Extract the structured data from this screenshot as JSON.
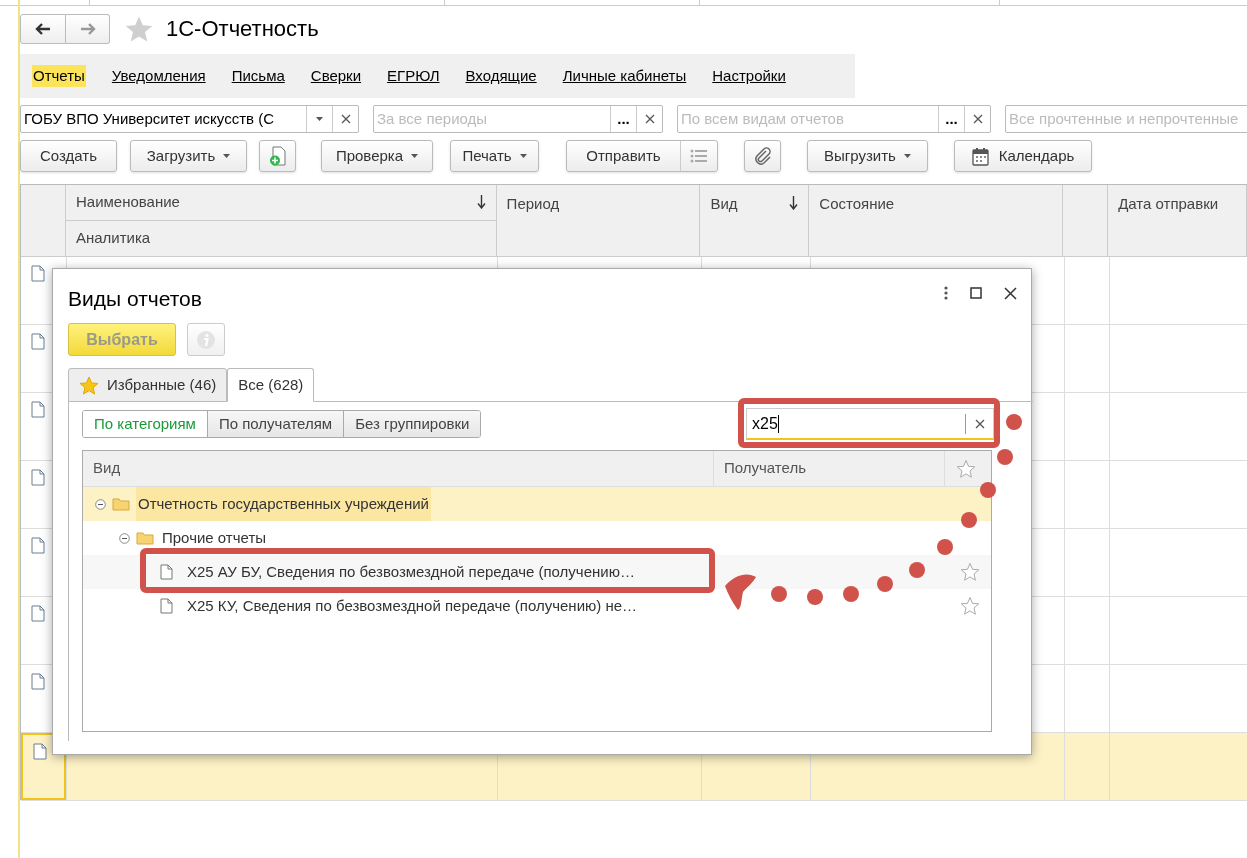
{
  "window": {
    "title": "1С-Отчетность",
    "favorite": false
  },
  "menu": [
    {
      "label": "Отчеты",
      "selected": true
    },
    {
      "label": "Уведомления",
      "selected": false
    },
    {
      "label": "Письма",
      "selected": false
    },
    {
      "label": "Сверки",
      "selected": false
    },
    {
      "label": "ЕГРЮЛ",
      "selected": false
    },
    {
      "label": "Входящие",
      "selected": false
    },
    {
      "label": "Личные кабинеты",
      "selected": false
    },
    {
      "label": "Настройки",
      "selected": false
    }
  ],
  "filters": [
    {
      "kind": "dropdown",
      "value": "ГОБУ ВПО Университет искусств (С"
    },
    {
      "kind": "choice",
      "placeholder": "За все периоды",
      "choose": "..."
    },
    {
      "kind": "choice",
      "placeholder": "По всем видам отчетов",
      "choose": "..."
    },
    {
      "kind": "plain",
      "placeholder": "Все прочтенные и непрочтенные"
    }
  ],
  "toolbar": [
    {
      "kind": "button",
      "label": "Создать"
    },
    {
      "kind": "menu",
      "label": "Загрузить"
    },
    {
      "kind": "new-doc"
    },
    {
      "kind": "menu",
      "label": "Проверка"
    },
    {
      "kind": "menu",
      "label": "Печать"
    },
    {
      "kind": "split",
      "label": "Отправить"
    },
    {
      "kind": "attach"
    },
    {
      "kind": "menu",
      "label": "Выгрузить"
    },
    {
      "kind": "calendar",
      "label": "Календарь"
    }
  ],
  "table": {
    "columns": [
      {
        "label": "Наименование",
        "sub": "Аналитика",
        "sort": true
      },
      {
        "label": "Период",
        "sort": false
      },
      {
        "label": "Вид",
        "sort": true
      },
      {
        "label": "Состояние",
        "sort": false
      },
      {
        "label": "Дата отправки",
        "sort": false
      }
    ],
    "rows": [
      {
        "selected": false
      },
      {
        "selected": false
      },
      {
        "selected": false
      },
      {
        "selected": false
      },
      {
        "selected": false
      },
      {
        "selected": false
      },
      {
        "selected": false
      },
      {
        "selected": true
      }
    ]
  },
  "dialog": {
    "title": "Виды отчетов",
    "select_button": {
      "label": "Выбрать",
      "disabled": true
    },
    "tabs": [
      {
        "label": "Избранные (46)",
        "selected": false
      },
      {
        "label": "Все (628)",
        "selected": true
      }
    ],
    "grouping": [
      {
        "label": "По категориям",
        "selected": true
      },
      {
        "label": "По получателям",
        "selected": false
      },
      {
        "label": "Без группировки",
        "selected": false
      }
    ],
    "search": {
      "value": "x25"
    },
    "columns": [
      "Вид",
      "Получатель"
    ],
    "tree": [
      {
        "label": "Отчетность государственных учреждений",
        "expanded": true,
        "selected": true,
        "children": [
          {
            "label": "Прочие отчеты",
            "expanded": true,
            "selected": false,
            "children": [
              {
                "label": "Х25 АУ БУ, Сведения по безвозмездной передаче (получению…",
                "selected": false,
                "favorite": false
              },
              {
                "label": "Х25 КУ, Сведения по безвозмездной передаче (получению) не…",
                "selected": false,
                "favorite": false
              }
            ]
          }
        ]
      }
    ]
  }
}
